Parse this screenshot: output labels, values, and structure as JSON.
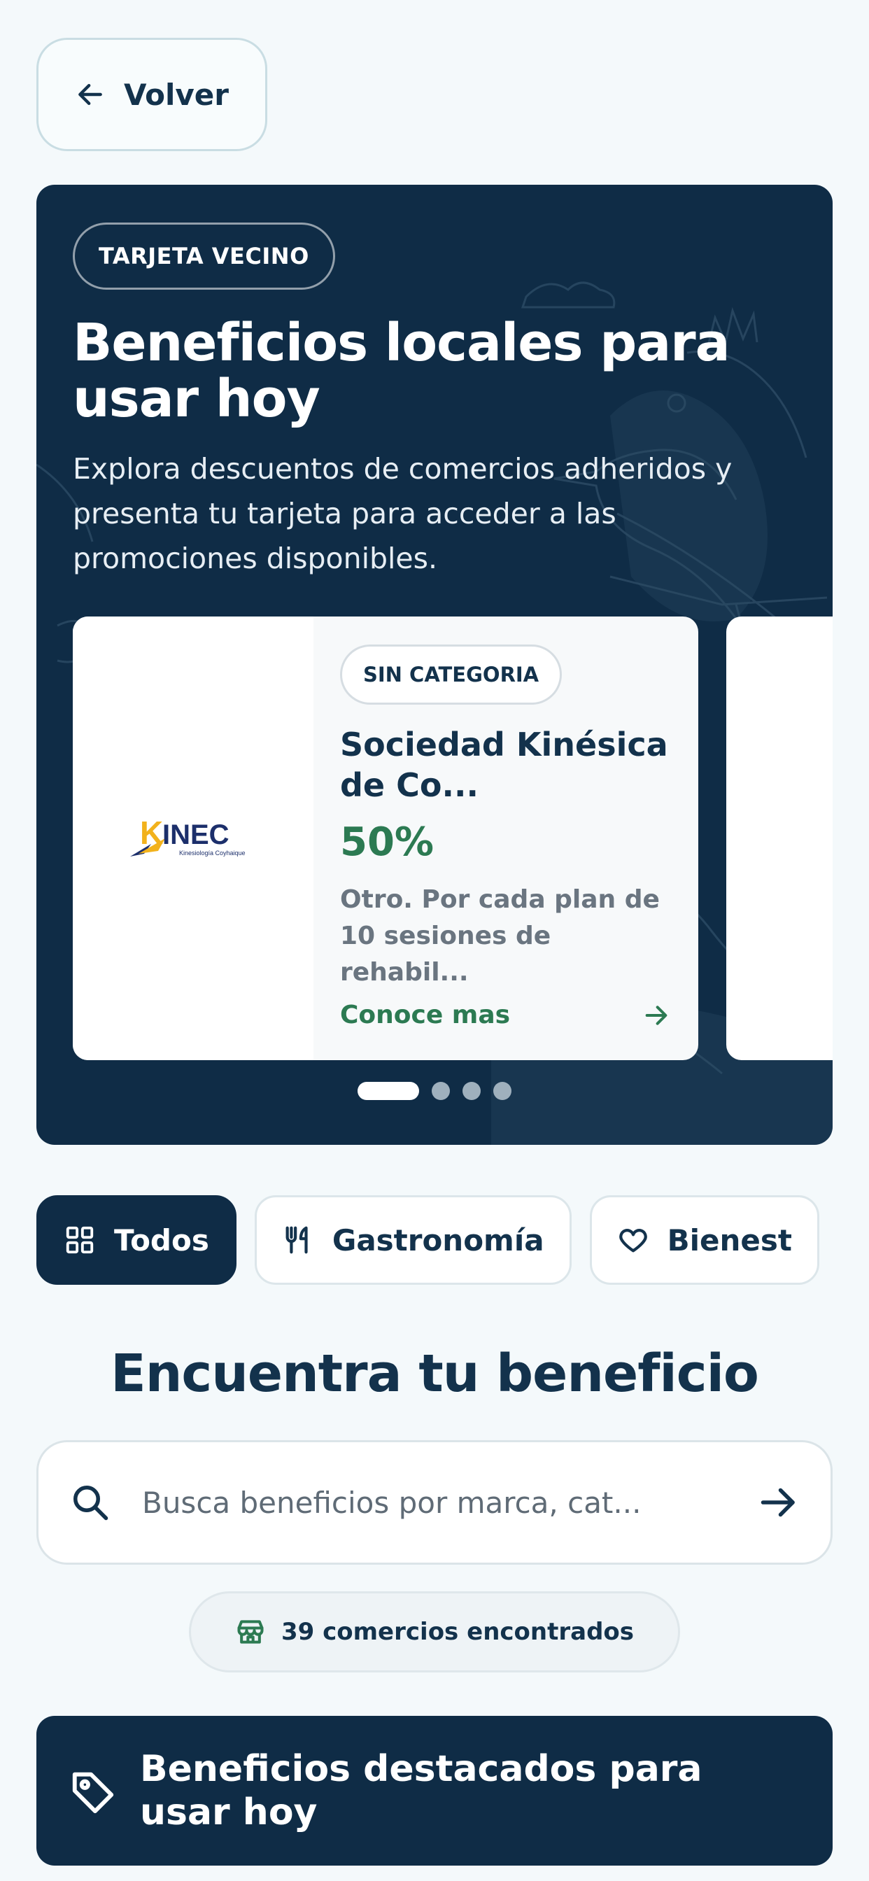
{
  "back": {
    "label": "Volver",
    "icon": "arrow-left-icon"
  },
  "hero": {
    "badge": "TARJETA VECINO",
    "title": "Beneficios locales para usar hoy",
    "subtitle": "Explora descuentos de comercios adheridos y presenta tu tarjeta para acceder a las promociones disponibles.",
    "colors": {
      "background": "#0f2c46"
    }
  },
  "offer": {
    "logo_text": "INEC",
    "logo_initial": "K",
    "logo_tagline": "Kinesiología Coyhaique",
    "category": "SIN CATEGORIA",
    "title": "Sociedad Kinésica de Co...",
    "discount": "50%",
    "description": "Otro. Por cada plan de 10 sesiones de rehabil...",
    "cta": "Conoce mas",
    "colors": {
      "accent": "#2c7a52"
    }
  },
  "carousel": {
    "total_slides": 4,
    "active_index": 0
  },
  "categories": [
    {
      "label": "Todos",
      "icon": "grid-icon",
      "active": true
    },
    {
      "label": "Gastronomía",
      "icon": "fork-knife-icon",
      "active": false
    },
    {
      "label": "Bienest",
      "icon": "heart-icon",
      "active": false
    }
  ],
  "search": {
    "heading": "Encuentra tu beneficio",
    "placeholder": "Busca beneficios por marca, cat...",
    "value": ""
  },
  "results": {
    "text": "39 comercios encontrados",
    "icon": "store-icon"
  },
  "featured": {
    "title": "Beneficios destacados para usar hoy",
    "icon": "tag-icon"
  }
}
